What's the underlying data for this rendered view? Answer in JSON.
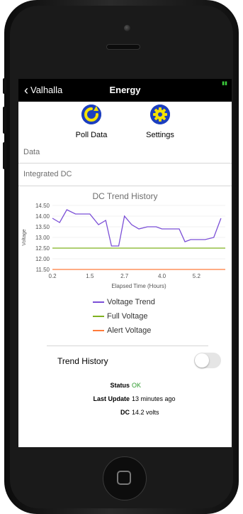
{
  "nav": {
    "back_label": "Valhalla",
    "title": "Energy"
  },
  "actions": {
    "poll": {
      "label": "Poll Data",
      "icon": "refresh-icon",
      "color": "#f4e200"
    },
    "settings": {
      "label": "Settings",
      "icon": "gear-icon",
      "color": "#f4e200"
    }
  },
  "sections": {
    "data_label": "Data",
    "integrated_label": "Integrated DC"
  },
  "chart": {
    "title": "DC Trend History",
    "ylabel": "Voltage",
    "xlabel": "Elapsed Time (Hours)",
    "yticks": [
      "14.50",
      "14.00",
      "13.50",
      "13.00",
      "12.50",
      "12.00",
      "11.50"
    ],
    "xticks": [
      "0.2",
      "1.5",
      "2.7",
      "4.0",
      "5.2"
    ],
    "legend": {
      "voltage": "Voltage Trend",
      "full": "Full Voltage",
      "alert": "Alert Voltage"
    }
  },
  "chart_data": {
    "type": "line",
    "title": "DC Trend History",
    "xlabel": "Elapsed Time (Hours)",
    "ylabel": "Voltage",
    "ylim": [
      11.5,
      14.5
    ],
    "xlim": [
      0.2,
      6.2
    ],
    "grid": true,
    "series": [
      {
        "name": "Voltage Trend",
        "color": "#7b4fd6",
        "x": [
          0.2,
          0.45,
          0.7,
          1.0,
          1.5,
          1.8,
          2.05,
          2.25,
          2.5,
          2.7,
          2.95,
          3.2,
          3.5,
          3.8,
          4.0,
          4.3,
          4.6,
          4.8,
          5.0,
          5.3,
          5.5,
          5.8,
          6.05
        ],
        "y": [
          13.9,
          13.7,
          14.3,
          14.1,
          14.1,
          13.6,
          13.8,
          12.6,
          12.6,
          14.0,
          13.6,
          13.4,
          13.5,
          13.5,
          13.4,
          13.4,
          13.4,
          12.8,
          12.9,
          12.9,
          12.9,
          13.0,
          13.9
        ]
      },
      {
        "name": "Full Voltage",
        "color": "#7fb21f",
        "x": [
          0.2,
          6.2
        ],
        "y": [
          12.5,
          12.5
        ]
      },
      {
        "name": "Alert Voltage",
        "color": "#ff7b3a",
        "x": [
          0.2,
          6.2
        ],
        "y": [
          11.5,
          11.5
        ]
      }
    ]
  },
  "trend_toggle": {
    "label": "Trend History",
    "on": false
  },
  "status": {
    "status_key": "Status",
    "status_value": "OK",
    "status_color": "#2e9b2e",
    "update_key": "Last Update",
    "update_value": "13 minutes ago",
    "dc_key": "DC",
    "dc_value": "14.2 volts"
  }
}
